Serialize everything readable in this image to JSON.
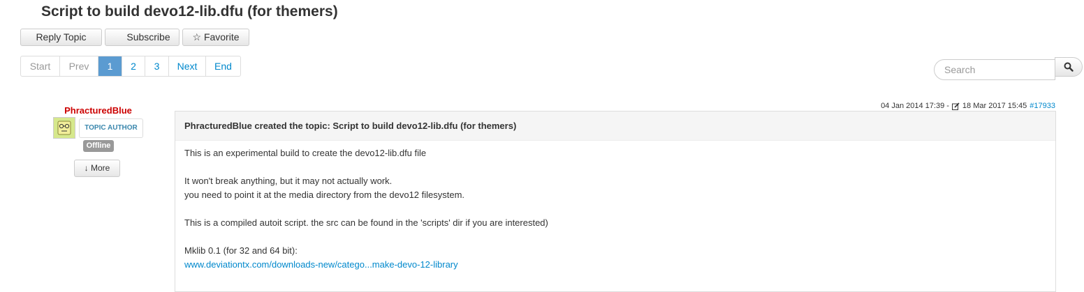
{
  "topic": {
    "title": "Script to build devo12-lib.dfu (for themers)"
  },
  "actions": {
    "reply_label": "Reply Topic",
    "subscribe_label": "Subscribe",
    "favorite_label": "Favorite"
  },
  "pagination": {
    "start": "Start",
    "prev": "Prev",
    "pages": [
      "1",
      "2",
      "3"
    ],
    "current": "1",
    "next": "Next",
    "end": "End"
  },
  "search": {
    "placeholder": "Search"
  },
  "author": {
    "name": "PhracturedBlue",
    "role": "TOPIC AUTHOR",
    "status": "Offline",
    "more_label": "More"
  },
  "post": {
    "created": "04 Jan 2014 17:39 -",
    "edited": "18 Mar 2017 15:45",
    "id_link": "#17933",
    "header": "PhracturedBlue created the topic: Script to build devo12-lib.dfu (for themers)",
    "lines": [
      "This is an experimental build to create the devo12-lib.dfu file",
      "",
      "It won't break anything, but it may not actually work.",
      "you need to point it at the media directory from the devo12 filesystem.",
      "",
      "This is a compiled autoit script. the src can be found in the 'scripts' dir if you are interested)",
      "",
      "Mklib 0.1 (for 32 and 64 bit):"
    ],
    "link": "www.deviationtx.com/downloads-new/catego...make-devo-12-library"
  },
  "colors": {
    "link": "#0088cc",
    "author_name": "#cc0000",
    "role_text": "#3a87ad",
    "active_page": "#5b9bd1",
    "status_badge": "#999999"
  },
  "icons": {
    "favorite": "star-icon",
    "more": "arrow-down-icon",
    "search": "magnifier-icon",
    "edit": "edit-icon",
    "avatar": "avatar-image"
  }
}
